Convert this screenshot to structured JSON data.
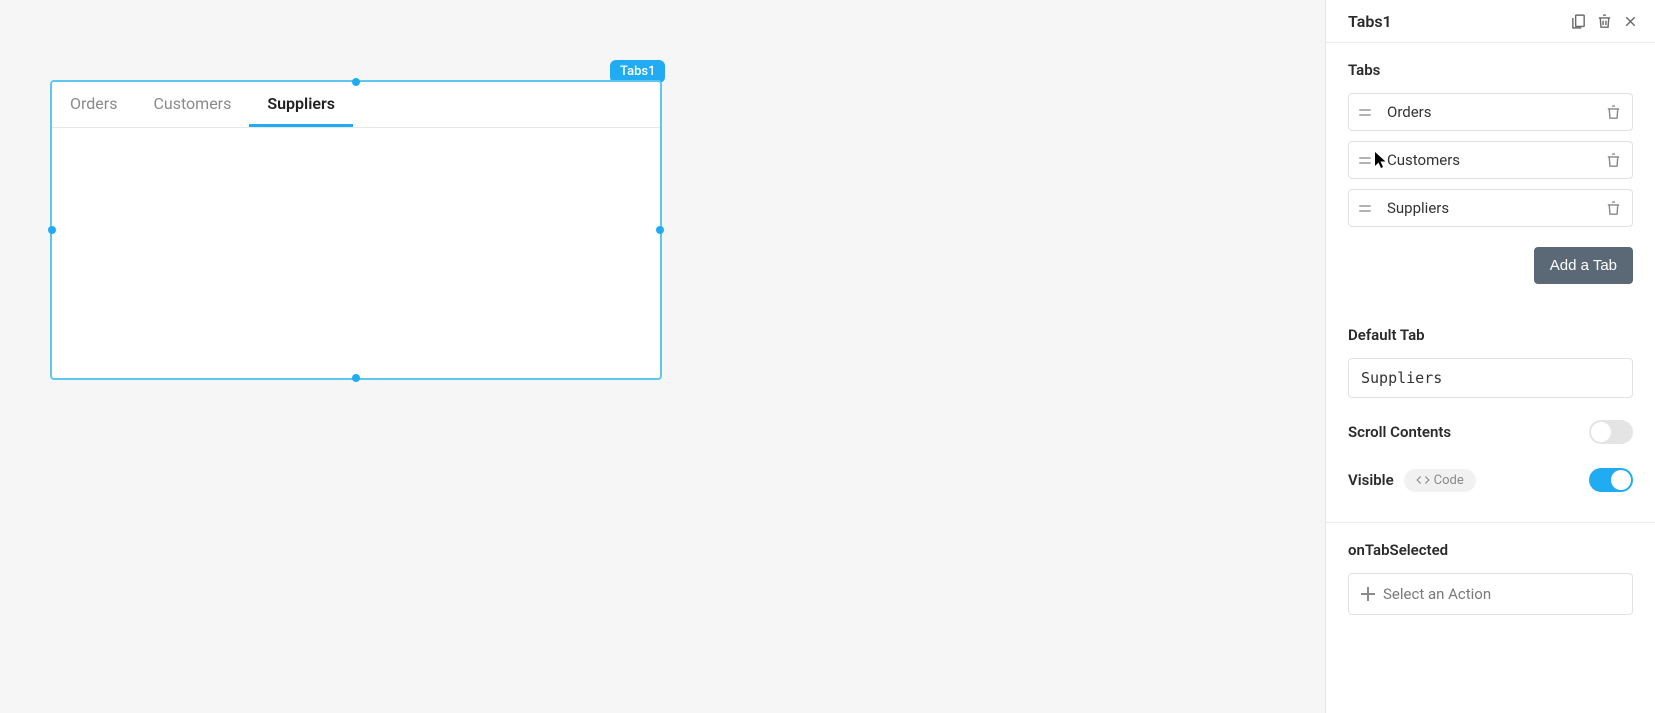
{
  "widget": {
    "badge_label": "Tabs1",
    "tabs": [
      {
        "label": "Orders",
        "active": false
      },
      {
        "label": "Customers",
        "active": false
      },
      {
        "label": "Suppliers",
        "active": true
      }
    ]
  },
  "panel": {
    "title": "Tabs1",
    "tabs_section_label": "Tabs",
    "tab_items": [
      {
        "label": "Orders"
      },
      {
        "label": "Customers"
      },
      {
        "label": "Suppliers"
      }
    ],
    "add_tab_label": "Add a Tab",
    "default_tab_label": "Default Tab",
    "default_tab_value": "Suppliers",
    "scroll_contents_label": "Scroll Contents",
    "scroll_contents_on": false,
    "visible_label": "Visible",
    "visible_on": true,
    "code_chip_label": "Code",
    "on_tab_selected_label": "onTabSelected",
    "select_action_placeholder": "Select an Action"
  }
}
